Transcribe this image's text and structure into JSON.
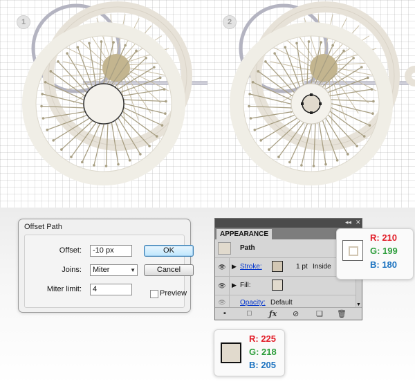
{
  "steps": [
    {
      "number": "1"
    },
    {
      "number": "2"
    }
  ],
  "offset_path_dialog": {
    "title": "Offset Path",
    "offset_label": "Offset:",
    "offset_value": "-10 px",
    "joins_label": "Joins:",
    "joins_value": "Miter",
    "miter_limit_label": "Miter limit:",
    "miter_limit_value": "4",
    "ok_label": "OK",
    "cancel_label": "Cancel",
    "preview_label": "Preview",
    "preview_checked": false
  },
  "appearance_panel": {
    "title": "APPEARANCE",
    "header_menu_icon": "menu-icon",
    "path_label": "Path",
    "stroke_label": "Stroke:",
    "stroke_weight": "1 pt",
    "stroke_align": "Inside",
    "fill_label": "Fill:",
    "opacity_label": "Opacity:",
    "opacity_value": "Default",
    "colors": {
      "stroke": "#d2c7b4",
      "fill": "#e1dacd",
      "path_thumb": "#e1dacd"
    }
  },
  "stroke_color_callout": {
    "r": "R: 210",
    "g": "G: 199",
    "b": "B: 180",
    "hex": "#d2c7b4"
  },
  "fill_color_callout": {
    "r": "R: 225",
    "g": "G: 218",
    "b": "B: 205",
    "hex": "#e1dacd"
  }
}
